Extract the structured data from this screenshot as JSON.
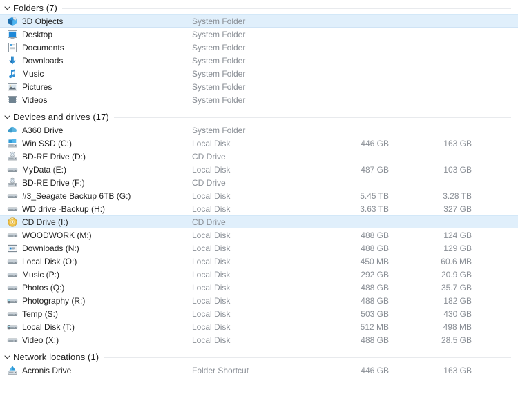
{
  "view": {
    "name": "this-pc-details-view",
    "background": "#ffffff",
    "selection_color": "#e0effb",
    "type_text_color": "#8a8f96"
  },
  "groups": [
    {
      "id": "folders",
      "title": "Folders (7)",
      "chevron": "chevron-down-icon",
      "items": [
        {
          "name": "3D Objects",
          "type": "System Folder",
          "total": "",
          "free": "",
          "icon": "3d-objects-icon",
          "selected": true
        },
        {
          "name": "Desktop",
          "type": "System Folder",
          "total": "",
          "free": "",
          "icon": "desktop-icon",
          "selected": false
        },
        {
          "name": "Documents",
          "type": "System Folder",
          "total": "",
          "free": "",
          "icon": "documents-icon",
          "selected": false
        },
        {
          "name": "Downloads",
          "type": "System Folder",
          "total": "",
          "free": "",
          "icon": "downloads-icon",
          "selected": false
        },
        {
          "name": "Music",
          "type": "System Folder",
          "total": "",
          "free": "",
          "icon": "music-note-icon",
          "selected": false
        },
        {
          "name": "Pictures",
          "type": "System Folder",
          "total": "",
          "free": "",
          "icon": "pictures-icon",
          "selected": false
        },
        {
          "name": "Videos",
          "type": "System Folder",
          "total": "",
          "free": "",
          "icon": "videos-icon",
          "selected": false
        }
      ]
    },
    {
      "id": "devices-and-drives",
      "title": "Devices and drives (17)",
      "chevron": "chevron-down-icon",
      "items": [
        {
          "name": "A360 Drive",
          "type": "System Folder",
          "total": "",
          "free": "",
          "icon": "cloud-drive-icon",
          "selected": false
        },
        {
          "name": "Win SSD (C:)",
          "type": "Local Disk",
          "total": "446 GB",
          "free": "163 GB",
          "icon": "windows-drive-icon",
          "selected": false
        },
        {
          "name": "BD-RE Drive (D:)",
          "type": "CD Drive",
          "total": "",
          "free": "",
          "icon": "optical-drive-icon",
          "selected": false
        },
        {
          "name": "MyData (E:)",
          "type": "Local Disk",
          "total": "487 GB",
          "free": "103 GB",
          "icon": "hard-drive-icon",
          "selected": false
        },
        {
          "name": "BD-RE Drive (F:)",
          "type": "CD Drive",
          "total": "",
          "free": "",
          "icon": "optical-drive-icon",
          "selected": false
        },
        {
          "name": "#3_Seagate Backup 6TB (G:)",
          "type": "Local Disk",
          "total": "5.45 TB",
          "free": "3.28 TB",
          "icon": "hard-drive-icon",
          "selected": false
        },
        {
          "name": "WD drive -Backup (H:)",
          "type": "Local Disk",
          "total": "3.63 TB",
          "free": "327 GB",
          "icon": "hard-drive-icon",
          "selected": false
        },
        {
          "name": "CD Drive (I:)",
          "type": "CD Drive",
          "total": "",
          "free": "",
          "icon": "cd-disc-icon",
          "selected": true
        },
        {
          "name": "WOODWORK (M:)",
          "type": "Local Disk",
          "total": "488 GB",
          "free": "124 GB",
          "icon": "hard-drive-icon",
          "selected": false
        },
        {
          "name": "Downloads (N:)",
          "type": "Local Disk",
          "total": "488 GB",
          "free": "129 GB",
          "icon": "custom-drive-icon",
          "selected": false
        },
        {
          "name": "Local Disk (O:)",
          "type": "Local Disk",
          "total": "450 MB",
          "free": "60.6 MB",
          "icon": "hard-drive-icon",
          "selected": false
        },
        {
          "name": "Music (P:)",
          "type": "Local Disk",
          "total": "292 GB",
          "free": "20.9 GB",
          "icon": "hard-drive-icon",
          "selected": false
        },
        {
          "name": "Photos (Q:)",
          "type": "Local Disk",
          "total": "488 GB",
          "free": "35.7 GB",
          "icon": "hard-drive-icon",
          "selected": false
        },
        {
          "name": "Photography (R:)",
          "type": "Local Disk",
          "total": "488 GB",
          "free": "182 GB",
          "icon": "network-drive-icon",
          "selected": false
        },
        {
          "name": "Temp (S:)",
          "type": "Local Disk",
          "total": "503 GB",
          "free": "430 GB",
          "icon": "hard-drive-icon",
          "selected": false
        },
        {
          "name": "Local Disk (T:)",
          "type": "Local Disk",
          "total": "512 MB",
          "free": "498 MB",
          "icon": "network-drive-icon",
          "selected": false
        },
        {
          "name": "Video (X:)",
          "type": "Local Disk",
          "total": "488 GB",
          "free": "28.5 GB",
          "icon": "hard-drive-icon",
          "selected": false
        }
      ]
    },
    {
      "id": "network-locations",
      "title": "Network locations (1)",
      "chevron": "chevron-down-icon",
      "items": [
        {
          "name": "Acronis Drive",
          "type": "Folder Shortcut",
          "total": "446 GB",
          "free": "163 GB",
          "icon": "acronis-drive-icon",
          "selected": false
        }
      ]
    }
  ]
}
